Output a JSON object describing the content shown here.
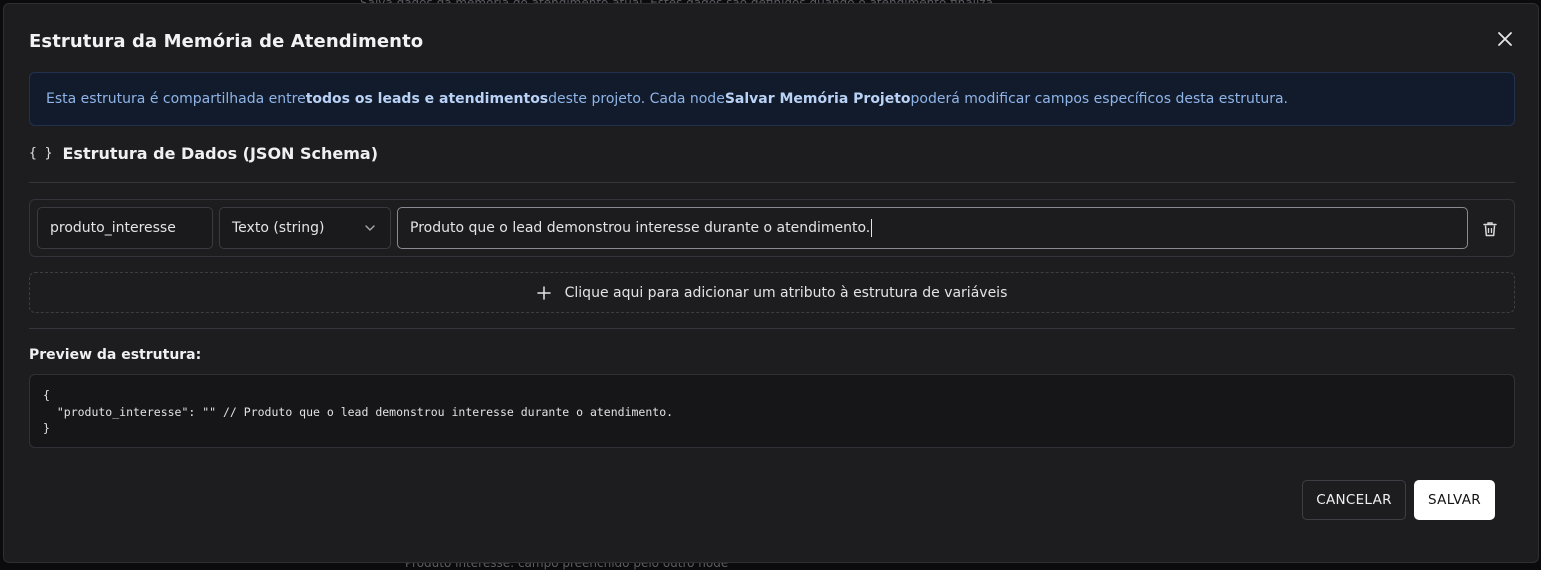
{
  "background": {
    "top_text": "Salva dados da memória do atendimento atual. Estes dados são definidos quando o atendimento finaliza.",
    "bottom_text": "Produto interesse: campo preenchido pelo outro node"
  },
  "modal": {
    "title": "Estrutura da Memória de Atendimento",
    "close_icon": "close-icon"
  },
  "banner": {
    "text_1": "Esta estrutura é compartilhada entre ",
    "bold_1": "todos os leads e atendimentos",
    "text_2": " deste projeto. Cada node ",
    "bold_2": "Salvar Memória Projeto",
    "text_3": " poderá modificar campos específicos desta estrutura."
  },
  "schema_section": {
    "icon_glyph": "{ }",
    "title": "Estrutura de Dados (JSON Schema)"
  },
  "attribute": {
    "name_value": "produto_interesse",
    "type_value": "Texto (string)",
    "description_value": "Produto que o lead demonstrou interesse durante o atendimento."
  },
  "add_attribute": {
    "label": "Clique aqui para adicionar um atributo à estrutura de variáveis"
  },
  "preview": {
    "label": "Preview da estrutura:",
    "code": "{\n  \"produto_interesse\": \"\" // Produto que o lead demonstrou interesse durante o atendimento.\n}"
  },
  "footer": {
    "cancel_label": "CANCELAR",
    "save_label": "SALVAR"
  },
  "colors": {
    "modal_bg": "#1d1d20",
    "banner_bg": "#121b2b",
    "banner_text": "#8fb4e8",
    "save_bg": "#ffffff"
  }
}
